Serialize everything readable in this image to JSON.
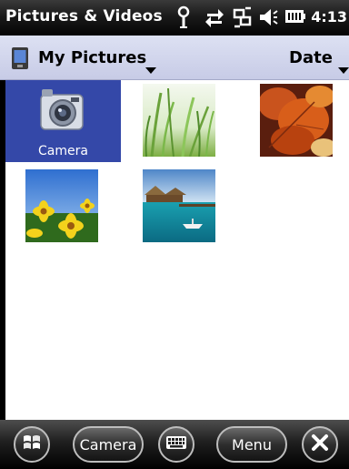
{
  "titlebar": {
    "title": "Pictures & Videos",
    "time": "4:13",
    "icons": [
      "signal-antenna-icon",
      "data-connection-icon",
      "connectivity-icon",
      "speaker-icon",
      "battery-icon"
    ]
  },
  "header": {
    "folder": "My Pictures",
    "sort": "Date",
    "background": "#d2d6ee"
  },
  "content": {
    "selection_color": "#3448a8",
    "items": [
      {
        "label": "Camera",
        "icon": "camera-icon",
        "selected": true
      },
      {
        "label": "",
        "icon": "grass-photo-icon",
        "selected": false
      },
      {
        "label": "",
        "icon": "autumn-leaf-photo-icon",
        "selected": false
      },
      {
        "label": "",
        "icon": "yellow-flowers-photo-icon",
        "selected": false
      },
      {
        "label": "",
        "icon": "tropical-beach-photo-icon",
        "selected": false
      }
    ]
  },
  "bottombar": {
    "start_icon": "windows-start-icon",
    "camera_label": "Camera",
    "keyboard_icon": "keyboard-icon",
    "menu_label": "Menu",
    "close_icon": "close-icon"
  }
}
